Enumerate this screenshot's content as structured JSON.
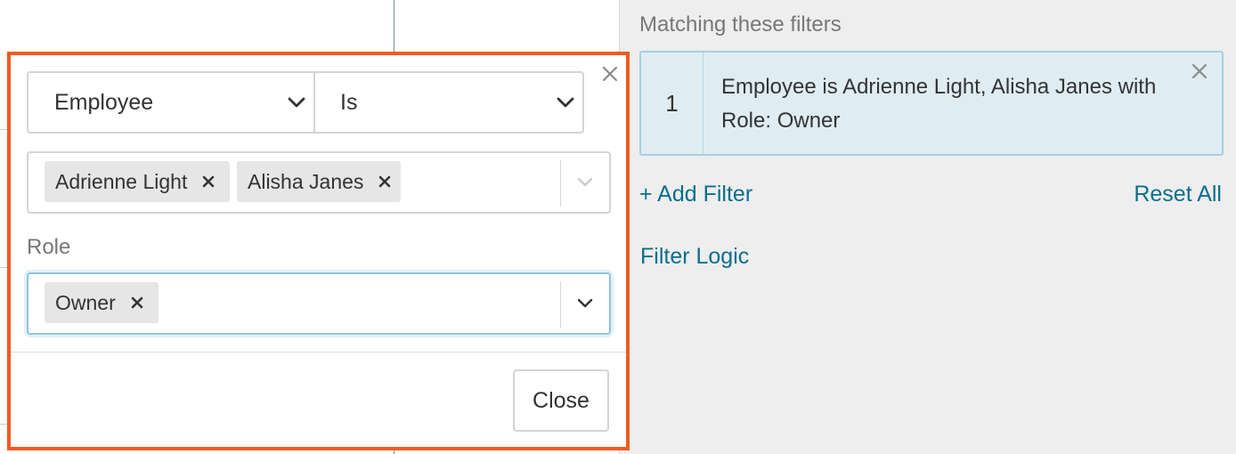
{
  "right_panel": {
    "title": "Matching these filters",
    "filters": [
      {
        "number": "1",
        "description": "Employee is Adrienne Light, Alisha Janes with Role: Owner"
      }
    ],
    "add_filter": "+ Add Filter",
    "reset_all": "Reset All",
    "filter_logic": "Filter Logic"
  },
  "popover": {
    "field_select": {
      "value": "Employee"
    },
    "operator_select": {
      "value": "Is"
    },
    "employee_values": [
      "Adrienne Light",
      "Alisha Janes"
    ],
    "role_label": "Role",
    "role_values": [
      "Owner"
    ],
    "close_button": "Close"
  },
  "colors": {
    "highlight_border": "#f15a22",
    "link": "#0a6e8c",
    "filter_card_bg": "#dfedf3",
    "focus_border": "#8fc5dd"
  },
  "icons": {
    "popover_close": "close-icon",
    "dropdown": "chevron-down-icon",
    "tag_remove": "remove-x-icon",
    "filter_remove": "close-icon"
  }
}
